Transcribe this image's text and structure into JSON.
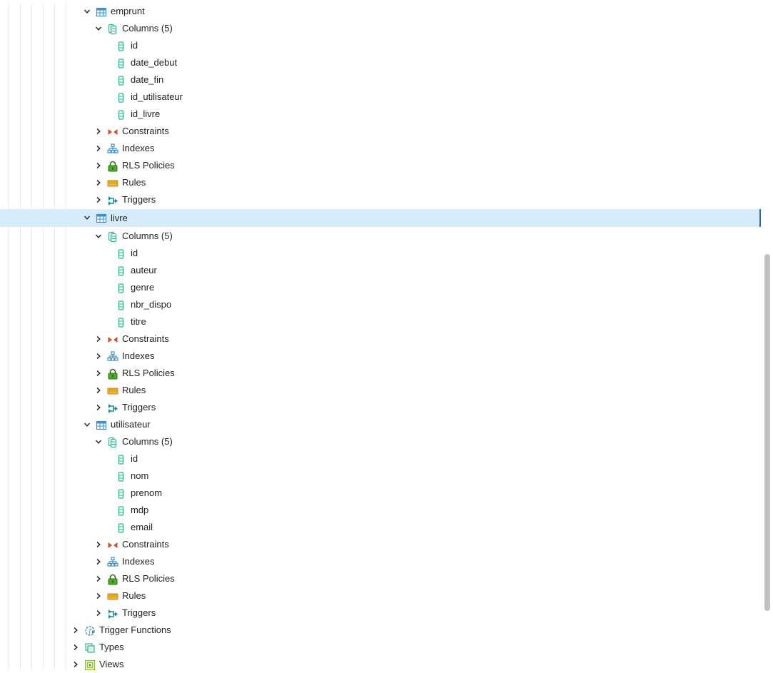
{
  "tables": [
    {
      "name": "emprunt",
      "columns_label": "Columns (5)",
      "columns": [
        "id",
        "date_debut",
        "date_fin",
        "id_utilisateur",
        "id_livre"
      ],
      "children": [
        "Constraints",
        "Indexes",
        "RLS Policies",
        "Rules",
        "Triggers"
      ],
      "selected": false
    },
    {
      "name": "livre",
      "columns_label": "Columns (5)",
      "columns": [
        "id",
        "auteur",
        "genre",
        "nbr_dispo",
        "titre"
      ],
      "children": [
        "Constraints",
        "Indexes",
        "RLS Policies",
        "Rules",
        "Triggers"
      ],
      "selected": true
    },
    {
      "name": "utilisateur",
      "columns_label": "Columns (5)",
      "columns": [
        "id",
        "nom",
        "prenom",
        "mdp",
        "email"
      ],
      "children": [
        "Constraints",
        "Indexes",
        "RLS Policies",
        "Rules",
        "Triggers"
      ],
      "selected": false
    }
  ],
  "schema_items": [
    {
      "label": "Trigger Functions",
      "icon": "trigger-function-icon"
    },
    {
      "label": "Types",
      "icon": "types-icon"
    },
    {
      "label": "Views",
      "icon": "views-icon"
    }
  ],
  "colors": {
    "selected_bg": "#d6ecfa",
    "selected_border": "#2a6fa8",
    "table_icon": "#3d8fd1",
    "column_icon": "#2fb38f",
    "constraint_icon": "#d9492b",
    "index_icon": "#3d8fd1",
    "rls_icon": "#4caf27",
    "rules_icon": "#f2b531",
    "triggers_icon": "#1b8c8c"
  }
}
